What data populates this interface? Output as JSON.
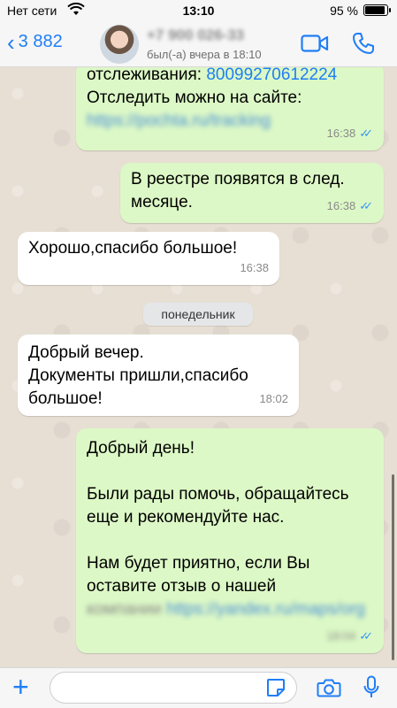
{
  "status_bar": {
    "carrier": "Нет сети",
    "time": "13:10",
    "battery_pct": "95 %",
    "battery_level": 0.95
  },
  "nav": {
    "back_count": "3 882",
    "contact_name": "+7 900 026-33",
    "last_seen": "был(-а) вчера в 18:10"
  },
  "messages": [
    {
      "lines": [
        "отслеживания: ",
        "Отследить можно на сайте:"
      ],
      "tracking_number": "80099270612224",
      "link_blurred": "https://pochta.ru/tracking",
      "time": "16:38",
      "direction": "out"
    },
    {
      "lines": [
        "В реестре появятся в след.",
        "месяце."
      ],
      "time": "16:38",
      "direction": "out"
    },
    {
      "lines": [
        "Хорошо,спасибо большое!"
      ],
      "time": "16:38",
      "direction": "in"
    },
    {
      "lines": [
        "Добрый вечер.",
        "Документы пришли,спасибо",
        "большое!"
      ],
      "time": "18:02",
      "direction": "in"
    },
    {
      "lines": [
        "Добрый день!",
        "Были рады помочь, обращайтесь",
        "еще и рекомендуйте нас.",
        "Нам будет приятно, если Вы",
        "оставите отзыв о нашей"
      ],
      "blurred_tail": "компании",
      "link_blurred": "https://yandex.ru/maps/org",
      "time": "18:04",
      "direction": "out"
    }
  ],
  "day_separator": "понедельник",
  "colors": {
    "accent": "#1f7ef6",
    "outgoing_bubble": "#dcf8c6",
    "incoming_bubble": "#ffffff",
    "chat_background": "#e7dfd4",
    "read_ticks": "#3497f9"
  }
}
